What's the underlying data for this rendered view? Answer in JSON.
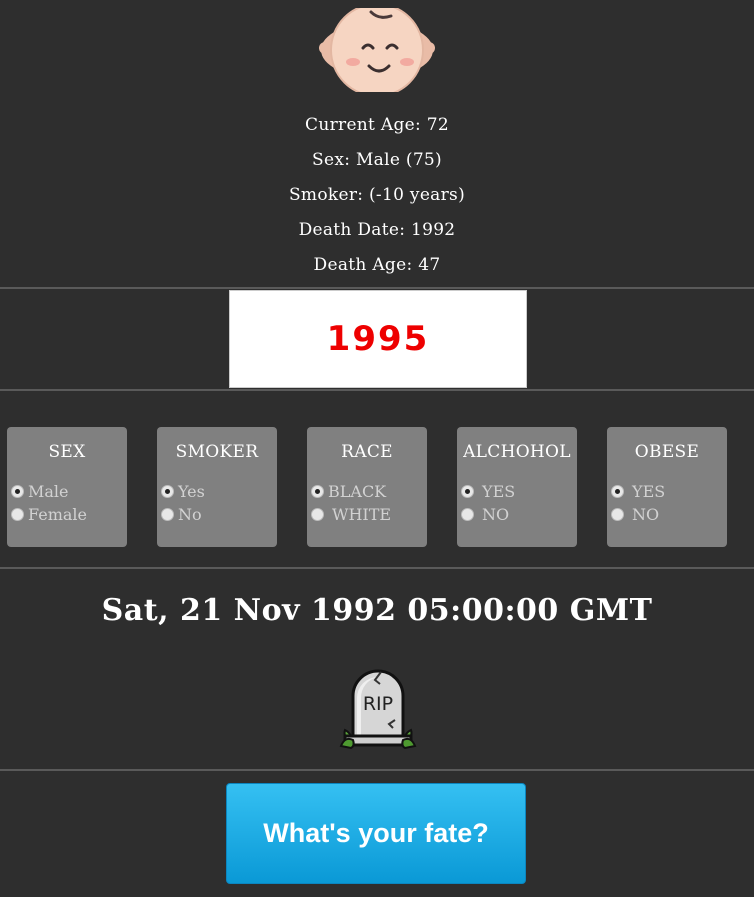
{
  "header": {
    "icon": "baby-face-icon"
  },
  "info": {
    "current_age": "Current Age: 72",
    "sex": "Sex: Male (75)",
    "smoker": "Smoker: (-10 years)",
    "death_date": "Death Date: 1992",
    "death_age": "Death Age: 47"
  },
  "year_display": {
    "value": "1995",
    "color": "#ee0000"
  },
  "cards": {
    "sex": {
      "title": "SEX",
      "options": [
        "Male",
        "Female"
      ],
      "selected": "Male"
    },
    "smoker": {
      "title": "SMOKER",
      "options": [
        "Yes",
        "No"
      ],
      "selected": "Yes"
    },
    "race": {
      "title": "RACE",
      "options": [
        "BLACK",
        "WHITE"
      ],
      "selected": "BLACK"
    },
    "alcohol": {
      "title": "ALCHOHOL",
      "options": [
        "YES",
        "NO"
      ],
      "selected": "YES"
    },
    "obese": {
      "title": "OBESE",
      "options": [
        "YES",
        "NO"
      ],
      "selected": "YES"
    }
  },
  "result": {
    "date_text": "Sat, 21 Nov 1992 05:00:00 GMT",
    "icon": "tombstone-icon",
    "rip_text": "RIP"
  },
  "action": {
    "fate_label": "What's your fate?",
    "color": "#1aa9e3"
  }
}
